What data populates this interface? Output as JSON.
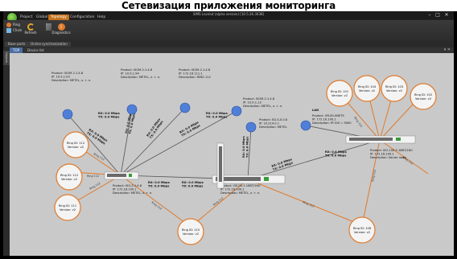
{
  "banner": "Сетевизация приложения мониторинга",
  "app": {
    "window_title": "SIMS Lavelut (alpha version) [10.5.26.3038]",
    "menu": [
      "Project",
      "Global",
      "Topology",
      "Configuration",
      "Help"
    ],
    "active_menu": "Topology",
    "ribbon": {
      "ring": "Ring",
      "chain": "Chain",
      "refresh": "Refresh",
      "diagnostics": "Diagnostics"
    },
    "view_tabs": [
      "Base parts",
      "Online synchronization"
    ],
    "rail_label": "Objects",
    "doc_tabs": [
      "TOP",
      "Device list"
    ],
    "pin": "▾ ✕"
  },
  "topology": {
    "colors": {
      "ring": "#e07a2b",
      "link": "#555555",
      "sync_link": "#e07a2b",
      "device_blue": "#4f7fd8"
    },
    "nodes": {
      "n1": {
        "line1": "Product: ISOM-2.1.4.8",
        "line2": "IP: 10.9.1.93",
        "line3": "Description: METEL, х. т. л."
      },
      "n2": {
        "line1": "Product: ISOM-2.1.4.8",
        "line2": "IP: 10.9.1.94",
        "line3": "Description: METEL, х. т. л."
      },
      "n3": {
        "line1": "Product: ISOM-2.1.4.8",
        "line2": "IP: 172.16.111.1",
        "line3": "Description: RING 112"
      },
      "n4": {
        "line1": "Product: ISOM-2.1.4.8",
        "line2": "IP: 10.9.1.13",
        "line3": "Description: METEL, х. т. л."
      },
      "n5": {
        "line1": "Product: ED-S-0.0.8",
        "line2": "IP: 10.214.0.1",
        "line3": "Description: METEL"
      },
      "lan": {
        "line1": "LAN",
        "line2": "Product: XR-00-0NETS",
        "line3": "IP: 172.16.100.1",
        "line4": "Description: IP:100 = 9000"
      },
      "switch_left": {
        "line1": "Product: ISG-2.1.4.8",
        "line2": "IP: 172.16.100.1",
        "line3": "Description: METEL, х. т. л."
      },
      "switch_mid": {
        "line1": "Product: GE-00-1-16BT/16U",
        "line2": "IP: 172.16.100.1",
        "line3": "Description: METEL, х. т. л."
      },
      "switch_right": {
        "line1": "Product: ISG-100-F-16BT/16U",
        "line2": "IP: 172.16.100.1",
        "line3": "Description: Server room"
      }
    },
    "rings": [
      {
        "label": "Ring ID: 112",
        "version": "Version: v2"
      },
      {
        "label": "Ring ID: 112",
        "version": "Version: v2"
      },
      {
        "label": "Ring ID: 111",
        "version": "Version: v2"
      },
      {
        "label": "Ring ID: 110",
        "version": "Version: v2"
      },
      {
        "label": "Ring ID: 101",
        "version": "Version: v2"
      },
      {
        "label": "Ring ID: 104",
        "version": "Version: v2"
      },
      {
        "label": "Ring ID: 103",
        "version": "Version: v2"
      },
      {
        "label": "Ring ID: 102",
        "version": "Version: v2"
      },
      {
        "label": "Ring ID: 108",
        "version": "Version: v2"
      }
    ],
    "link_rx": "RX: 0.0 Mbps",
    "link_tx": "TX: 0.0 Mbps",
    "ring_edge": "Ring 112"
  }
}
